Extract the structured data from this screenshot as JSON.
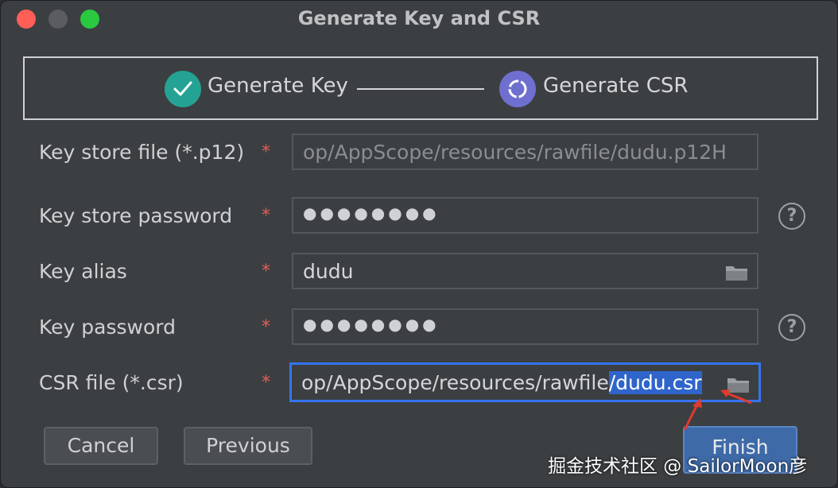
{
  "window": {
    "title": "Generate Key and CSR"
  },
  "stepper": {
    "step1": {
      "label": "Generate Key",
      "status": "complete"
    },
    "step2": {
      "label": "Generate CSR",
      "status": "in-progress"
    }
  },
  "form": {
    "key_store_file": {
      "label": "Key store file (*.p12)",
      "required": "*",
      "value": "op/AppScope/resources/rawfile/dudu.p12H"
    },
    "key_store_password": {
      "label": "Key store password",
      "required": "*",
      "value": "●●●●●●●●"
    },
    "key_alias": {
      "label": "Key alias",
      "required": "*",
      "value": "dudu"
    },
    "key_password": {
      "label": "Key password",
      "required": "*",
      "value": "●●●●●●●●"
    },
    "csr_file": {
      "label": "CSR file (*.csr)",
      "required": "*",
      "value_prefix": "op/AppScope/resources/rawfile",
      "value_selected": "/dudu.csr"
    }
  },
  "help": {
    "symbol": "?"
  },
  "buttons": {
    "cancel": "Cancel",
    "previous": "Previous",
    "finish": "Finish"
  },
  "watermark": "掘金技术社区 @ SailorMoon彦",
  "icons": {
    "step1": "check-circle-icon",
    "step2": "progress-circle-icon",
    "browse": "folder-icon",
    "help": "help-icon"
  },
  "colors": {
    "accent": "#3574f0",
    "selection": "#2f65ca",
    "required": "#e0605c",
    "step_complete": "#24a394",
    "step_current": "#6f6fd0",
    "annotation_arrow": "#e03a2f"
  }
}
